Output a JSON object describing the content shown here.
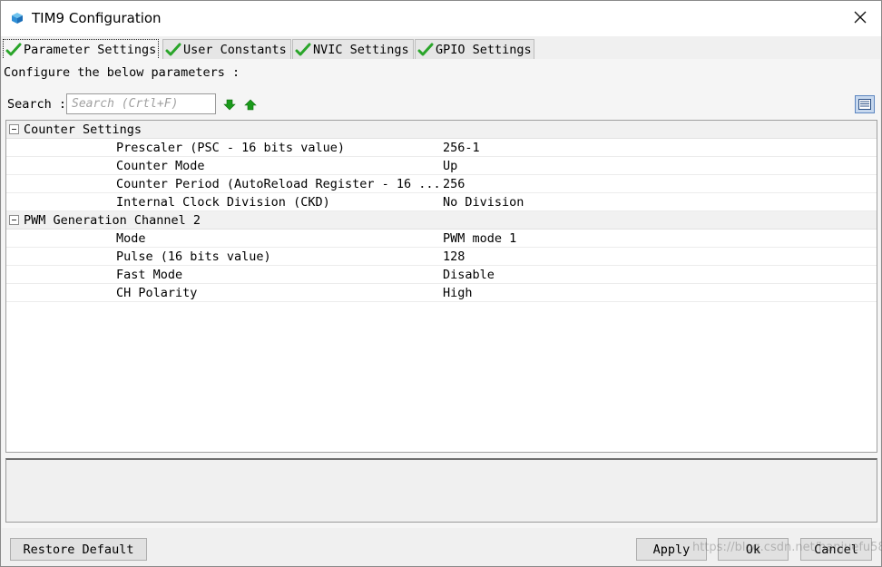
{
  "window": {
    "title": "TIM9 Configuration",
    "icon": "cube-icon",
    "close_icon": "close-icon"
  },
  "tabs": [
    {
      "label": "Parameter Settings",
      "active": true,
      "icon": "check-icon"
    },
    {
      "label": "User Constants",
      "active": false,
      "icon": "check-icon"
    },
    {
      "label": "NVIC Settings",
      "active": false,
      "icon": "check-icon"
    },
    {
      "label": "GPIO Settings",
      "active": false,
      "icon": "check-icon"
    }
  ],
  "intro_text": "Configure the below parameters :",
  "search": {
    "label": "Search :",
    "placeholder": "Search (Crtl+F)",
    "value": "",
    "next_icon": "arrow-down-icon",
    "prev_icon": "arrow-up-icon"
  },
  "view_toggle_icon": "list-view-icon",
  "groups": [
    {
      "label": "Counter Settings",
      "expanded": true,
      "rows": [
        {
          "name": "Prescaler (PSC - 16 bits value)",
          "value": "256-1"
        },
        {
          "name": "Counter Mode",
          "value": "Up"
        },
        {
          "name": "Counter Period (AutoReload Register - 16 ...",
          "value": "256"
        },
        {
          "name": "Internal Clock Division (CKD)",
          "value": "No Division"
        }
      ]
    },
    {
      "label": "PWM Generation Channel 2",
      "expanded": true,
      "rows": [
        {
          "name": "Mode",
          "value": "PWM mode 1"
        },
        {
          "name": "Pulse (16 bits value)",
          "value": "128"
        },
        {
          "name": "Fast Mode",
          "value": "Disable"
        },
        {
          "name": "CH Polarity",
          "value": "High"
        }
      ]
    }
  ],
  "buttons": {
    "restore": "Restore Default",
    "apply": "Apply",
    "ok": "Ok",
    "cancel": "Cancel"
  },
  "watermark": "https://blog.csdn.net/hanjuefu5827",
  "colors": {
    "check_green": "#2aa52a",
    "arrow_green": "#1a9a1a",
    "accent_blue": "#5d86c0"
  }
}
